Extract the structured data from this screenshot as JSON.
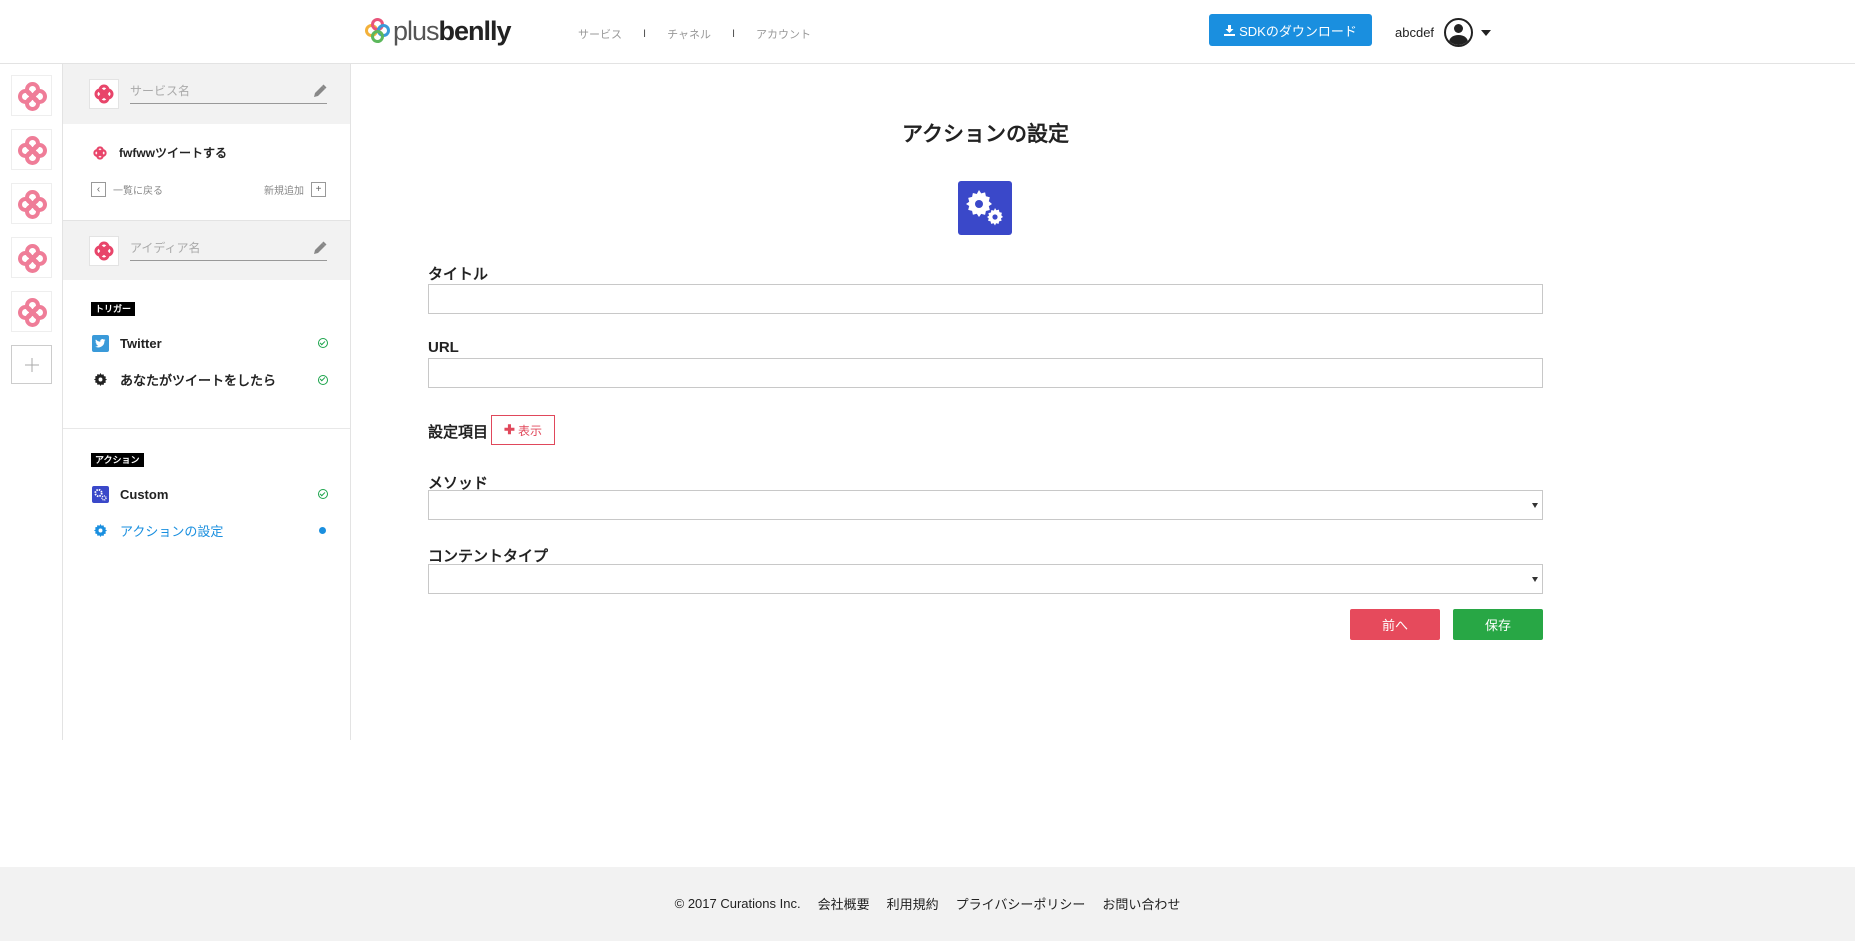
{
  "header": {
    "logo": {
      "plus": "plus",
      "benlly": "benlly"
    },
    "nav": [
      "サービス",
      "チャネル",
      "アカウント"
    ],
    "nav_separator": "I",
    "sdk_button": "SDKのダウンロード",
    "username": "abcdef"
  },
  "sidebar": {
    "service_name_placeholder": "サービス名",
    "service_title": "fwfwwツイートする",
    "back_label": "一覧に戻る",
    "new_label": "新規追加",
    "idea_name_placeholder": "アイディア名",
    "trigger_tag": "トリガー",
    "trigger_steps": [
      {
        "label": "Twitter",
        "icon": "twitter-icon",
        "status": "done"
      },
      {
        "label": "あなたがツイートをしたら",
        "icon": "gear-icon",
        "status": "done"
      }
    ],
    "action_tag": "アクション",
    "action_steps": [
      {
        "label": "Custom",
        "icon": "custom-gears-icon",
        "status": "done"
      },
      {
        "label": "アクションの設定",
        "icon": "gear-icon",
        "status": "current"
      }
    ]
  },
  "main": {
    "title": "アクションの設定",
    "fields": {
      "title_label": "タイトル",
      "title_value": "",
      "url_label": "URL",
      "url_value": "",
      "settings_label": "設定項目",
      "show_button": "表示",
      "method_label": "メソッド",
      "method_value": "",
      "content_type_label": "コンテントタイプ",
      "content_type_value": ""
    },
    "prev_button": "前へ",
    "save_button": "保存"
  },
  "footer": {
    "copyright": "© 2017 Curations Inc.",
    "links": [
      "会社概要",
      "利用規約",
      "プライバシーポリシー",
      "お問い合わせ"
    ]
  },
  "colors": {
    "accent_blue": "#1a8fdf",
    "danger_red": "#e64a5c",
    "success_green": "#28a745",
    "knot_pink": "#ef7d98",
    "gear_box": "#3a48c9"
  }
}
